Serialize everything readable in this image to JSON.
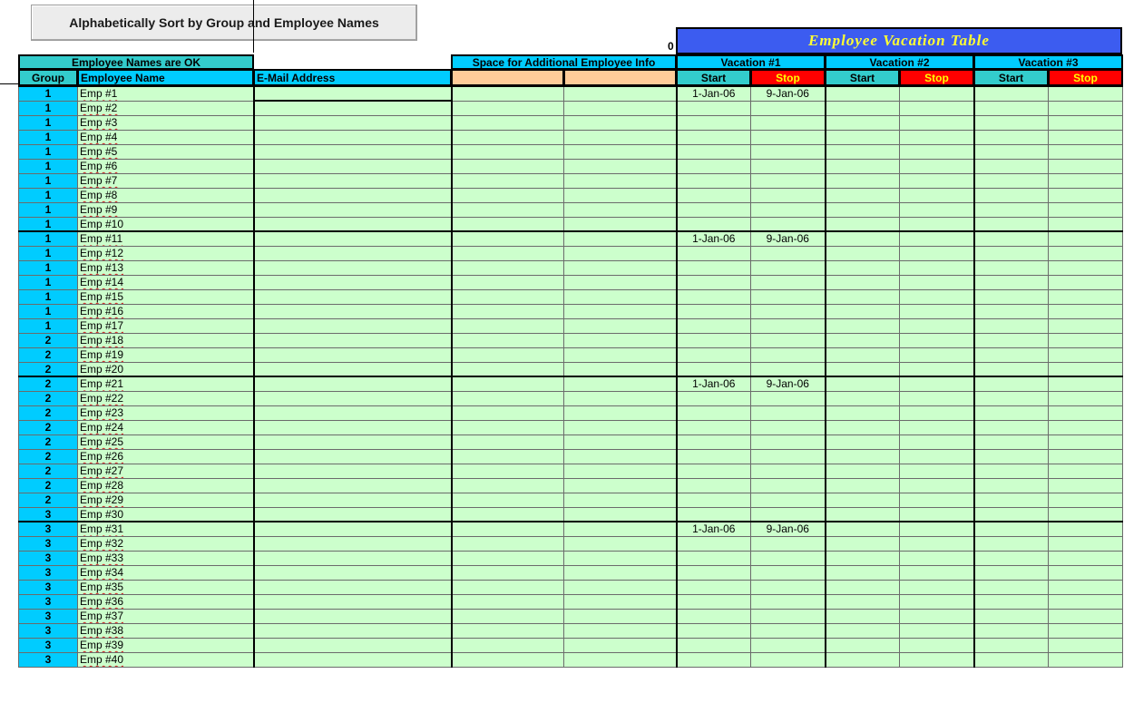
{
  "sort_button": "Alphabetically Sort by Group and Employee Names",
  "counter": "0",
  "title": "Employee Vacation Table",
  "headers": {
    "names_ok": "Employee Names are OK",
    "space_info": "Space for Additional Employee Info",
    "group": "Group",
    "employee_name": "Employee Name",
    "email": "E-Mail Address",
    "vacations": [
      "Vacation #1",
      "Vacation #2",
      "Vacation #3"
    ],
    "start": "Start",
    "stop": "Stop"
  },
  "colors": {
    "cyan": "#00ccff",
    "teal": "#33cccc",
    "peach": "#ffcc99",
    "green": "#ccffcc",
    "red": "#ff0000",
    "title_bg": "#3c5cf0",
    "title_text": "#ffff33"
  },
  "rows": [
    {
      "group": "1",
      "name": "Emp #1",
      "v1_start": "1-Jan-06",
      "v1_stop": "9-Jan-06"
    },
    {
      "group": "1",
      "name": "Emp #2"
    },
    {
      "group": "1",
      "name": "Emp #3"
    },
    {
      "group": "1",
      "name": "Emp #4"
    },
    {
      "group": "1",
      "name": "Emp #5"
    },
    {
      "group": "1",
      "name": "Emp #6"
    },
    {
      "group": "1",
      "name": "Emp #7"
    },
    {
      "group": "1",
      "name": "Emp #8"
    },
    {
      "group": "1",
      "name": "Emp #9"
    },
    {
      "group": "1",
      "name": "Emp #10"
    },
    {
      "group": "1",
      "name": "Emp #11",
      "v1_start": "1-Jan-06",
      "v1_stop": "9-Jan-06"
    },
    {
      "group": "1",
      "name": "Emp #12"
    },
    {
      "group": "1",
      "name": "Emp #13"
    },
    {
      "group": "1",
      "name": "Emp #14"
    },
    {
      "group": "1",
      "name": "Emp #15"
    },
    {
      "group": "1",
      "name": "Emp #16"
    },
    {
      "group": "1",
      "name": "Emp #17"
    },
    {
      "group": "2",
      "name": "Emp #18"
    },
    {
      "group": "2",
      "name": "Emp #19"
    },
    {
      "group": "2",
      "name": "Emp #20"
    },
    {
      "group": "2",
      "name": "Emp #21",
      "v1_start": "1-Jan-06",
      "v1_stop": "9-Jan-06"
    },
    {
      "group": "2",
      "name": "Emp #22"
    },
    {
      "group": "2",
      "name": "Emp #23"
    },
    {
      "group": "2",
      "name": "Emp #24"
    },
    {
      "group": "2",
      "name": "Emp #25"
    },
    {
      "group": "2",
      "name": "Emp #26"
    },
    {
      "group": "2",
      "name": "Emp #27"
    },
    {
      "group": "2",
      "name": "Emp #28"
    },
    {
      "group": "2",
      "name": "Emp #29"
    },
    {
      "group": "3",
      "name": "Emp #30"
    },
    {
      "group": "3",
      "name": "Emp #31",
      "v1_start": "1-Jan-06",
      "v1_stop": "9-Jan-06"
    },
    {
      "group": "3",
      "name": "Emp #32"
    },
    {
      "group": "3",
      "name": "Emp #33"
    },
    {
      "group": "3",
      "name": "Emp #34"
    },
    {
      "group": "3",
      "name": "Emp #35"
    },
    {
      "group": "3",
      "name": "Emp #36"
    },
    {
      "group": "3",
      "name": "Emp #37"
    },
    {
      "group": "3",
      "name": "Emp #38"
    },
    {
      "group": "3",
      "name": "Emp #39"
    },
    {
      "group": "3",
      "name": "Emp #40"
    }
  ]
}
